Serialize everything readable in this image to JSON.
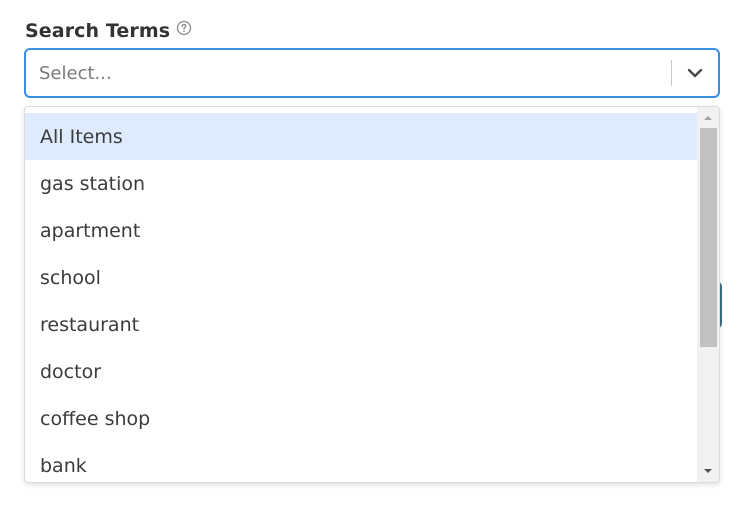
{
  "field": {
    "label": "Search Terms",
    "help_icon": "question-circle-icon"
  },
  "select": {
    "placeholder": "Select...",
    "chevron_icon": "chevron-down-icon"
  },
  "menu": {
    "items": [
      {
        "label": "All Items",
        "active": true
      },
      {
        "label": "gas station"
      },
      {
        "label": "apartment"
      },
      {
        "label": "school"
      },
      {
        "label": "restaurant"
      },
      {
        "label": "doctor"
      },
      {
        "label": "coffee shop"
      },
      {
        "label": "bank"
      }
    ]
  },
  "colors": {
    "focus_border": "#3a8ee6",
    "active_item_bg": "#deebff",
    "behind_button": "#3b6f86"
  }
}
